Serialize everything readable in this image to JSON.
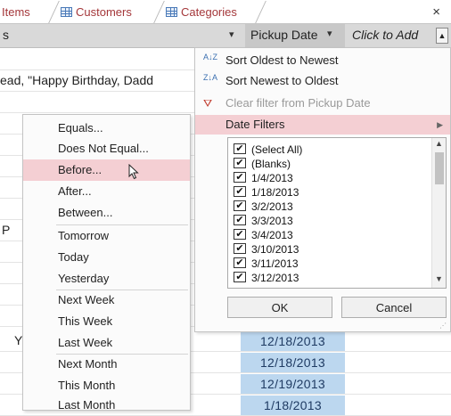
{
  "tabs": [
    {
      "label": "Items"
    },
    {
      "label": "Customers"
    },
    {
      "label": "Categories"
    }
  ],
  "close_symbol": "×",
  "header": {
    "left_fragment": "s",
    "pickup_date": "Pickup Date",
    "click_to_add": "Click to Add",
    "dropdown_icon": "▾"
  },
  "rows_text": {
    "birthday": "ead, \"Happy Birthday, Dadd",
    "frag_p": "P",
    "frag_y": "Y"
  },
  "filter_menu": {
    "sort_oldest": "Sort Oldest to Newest",
    "sort_newest": "Sort Newest to Oldest",
    "clear_filter": "Clear filter from Pickup Date",
    "date_filters": "Date Filters",
    "list_items": [
      "(Select All)",
      "(Blanks)",
      "1/4/2013",
      "1/18/2013",
      "3/2/2013",
      "3/3/2013",
      "3/4/2013",
      "3/10/2013",
      "3/11/2013",
      "3/12/2013"
    ],
    "ok": "OK",
    "cancel": "Cancel",
    "check_mark": "✔",
    "sort_icon_asc": "A↓Z",
    "sort_icon_desc": "Z↓A"
  },
  "date_submenu": {
    "items": [
      "Equals...",
      "Does Not Equal...",
      "Before...",
      "After...",
      "Between...",
      "Tomorrow",
      "Today",
      "Yesterday",
      "Next Week",
      "This Week",
      "Last Week",
      "Next Month",
      "This Month",
      "Last Month"
    ]
  },
  "dates": [
    "12/18/2013",
    "12/18/2013",
    "12/19/2013",
    "1/18/2013"
  ],
  "colors": {
    "highlight": "#f4cfd3",
    "date_cell": "#bcd7ef",
    "tab_text": "#a4373a"
  }
}
